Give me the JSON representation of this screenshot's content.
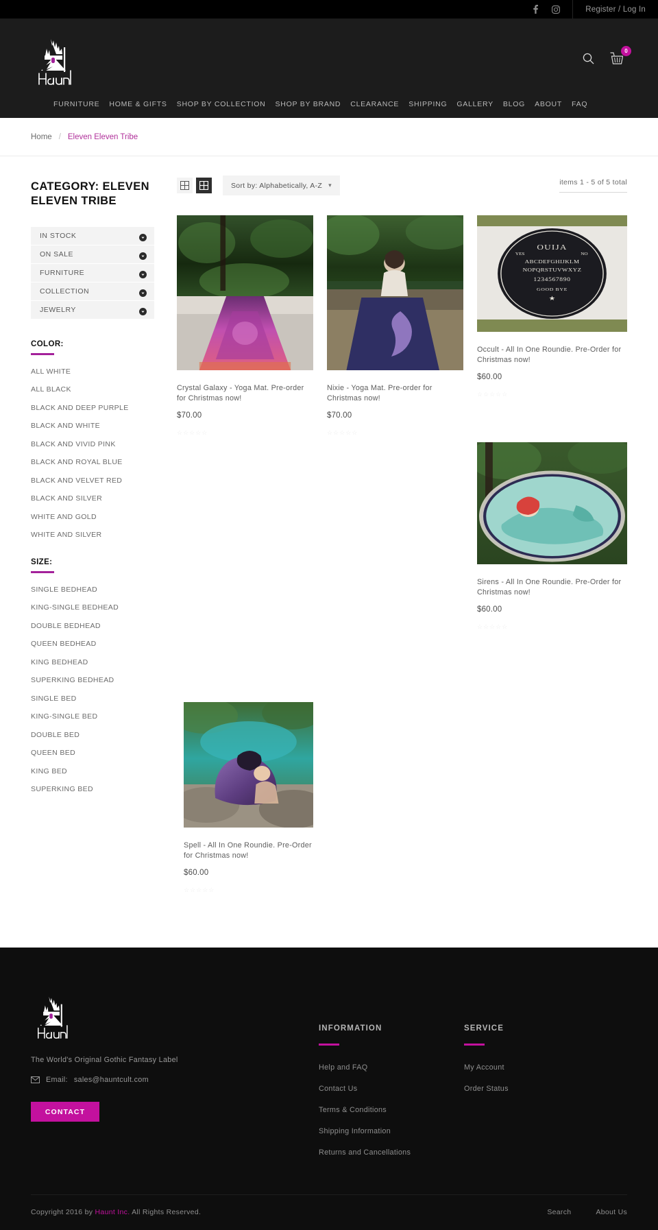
{
  "topbar": {
    "social": [
      {
        "name": "facebook-icon",
        "label": "f"
      },
      {
        "name": "instagram-icon",
        "label": ""
      }
    ],
    "account_link": "Register / Log In"
  },
  "header": {
    "logo_alt": "Haunt",
    "search_icon": "search-icon",
    "cart_icon": "cart-icon",
    "cart_count": "0",
    "nav": [
      "FURNITURE",
      "HOME & GIFTS",
      "SHOP BY COLLECTION",
      "SHOP BY BRAND",
      "CLEARANCE",
      "SHIPPING",
      "GALLERY",
      "BLOG",
      "ABOUT",
      "FAQ"
    ]
  },
  "breadcrumb": {
    "home": "Home",
    "separator": "/",
    "current": "Eleven Eleven Tribe"
  },
  "sidebar": {
    "category_title": "CATEGORY: ELEVEN ELEVEN TRIBE",
    "accordion": [
      "IN STOCK",
      "ON SALE",
      "FURNITURE",
      "COLLECTION",
      "JEWELRY"
    ],
    "color": {
      "title": "COLOR:",
      "options": [
        "ALL WHITE",
        "ALL BLACK",
        "BLACK AND DEEP PURPLE",
        "BLACK AND WHITE",
        "BLACK AND VIVID PINK",
        "BLACK AND ROYAL BLUE",
        "BLACK AND VELVET RED",
        "BLACK AND SILVER",
        "WHITE AND GOLD",
        "WHITE AND SILVER"
      ]
    },
    "size": {
      "title": "SIZE:",
      "options": [
        "SINGLE BEDHEAD",
        "KING-SINGLE BEDHEAD",
        "DOUBLE BEDHEAD",
        "QUEEN BEDHEAD",
        "KING BEDHEAD",
        "SUPERKING BEDHEAD",
        "SINGLE BED",
        "KING-SINGLE BED",
        "DOUBLE BED",
        "QUEEN BED",
        "KING BED",
        "SUPERKING BED"
      ]
    }
  },
  "toolbar": {
    "view_grid_icon": "grid-view-icon",
    "view_grid_large_icon": "grid-large-view-icon",
    "sort_label": "Sort by: Alphabetically, A-Z",
    "sort_chevron": "chevron-down-icon",
    "items_count": "items 1 - 5 of 5 total"
  },
  "products": [
    {
      "title": "Crystal Galaxy - Yoga Mat. Pre-order for Christmas now!",
      "price": "$70.00",
      "rating": "☆☆☆☆☆",
      "image": "crystal-galaxy-yoga-mat"
    },
    {
      "title": "Nixie - Yoga Mat. Pre-order for Christmas now!",
      "price": "$70.00",
      "rating": "☆☆☆☆☆",
      "image": "nixie-yoga-mat"
    },
    {
      "title": "Occult - All In One Roundie. Pre-Order for Christmas now!",
      "price": "$60.00",
      "rating": "☆☆☆☆☆",
      "image": "occult-roundie"
    },
    {
      "title": "Sirens - All In One Roundie. Pre-Order for Christmas now!",
      "price": "$60.00",
      "rating": "☆☆☆☆☆",
      "image": "sirens-roundie"
    },
    {
      "title": "Spell - All In One Roundie. Pre-Order for Christmas now!",
      "price": "$60.00",
      "rating": "☆☆☆☆☆",
      "image": "spell-roundie"
    }
  ],
  "footer": {
    "logo_alt": "Haunt",
    "tagline": "The World's Original Gothic Fantasy Label",
    "email_prefix": "Email:",
    "email": "sales@hauntcult.com",
    "contact_button": "CONTACT",
    "information": {
      "heading": "INFORMATION",
      "links": [
        "Help and FAQ",
        "Contact Us",
        "Terms & Conditions",
        "Shipping Information",
        "Returns and Cancellations"
      ]
    },
    "service": {
      "heading": "SERVICE",
      "links": [
        "My Account",
        "Order Status"
      ]
    },
    "copyright_prefix": "Copyright 2016 by",
    "copyright_brand": "Haunt Inc.",
    "copyright_suffix": "All Rights Reserved.",
    "bottom_links": [
      "Search",
      "About Us"
    ]
  },
  "colors": {
    "accent_pink": "#c3119e",
    "accent_purple": "#a3209a",
    "header_bg": "#1c1c1c",
    "topbar_bg": "#000000",
    "footer_bg": "#0e0e0e"
  }
}
